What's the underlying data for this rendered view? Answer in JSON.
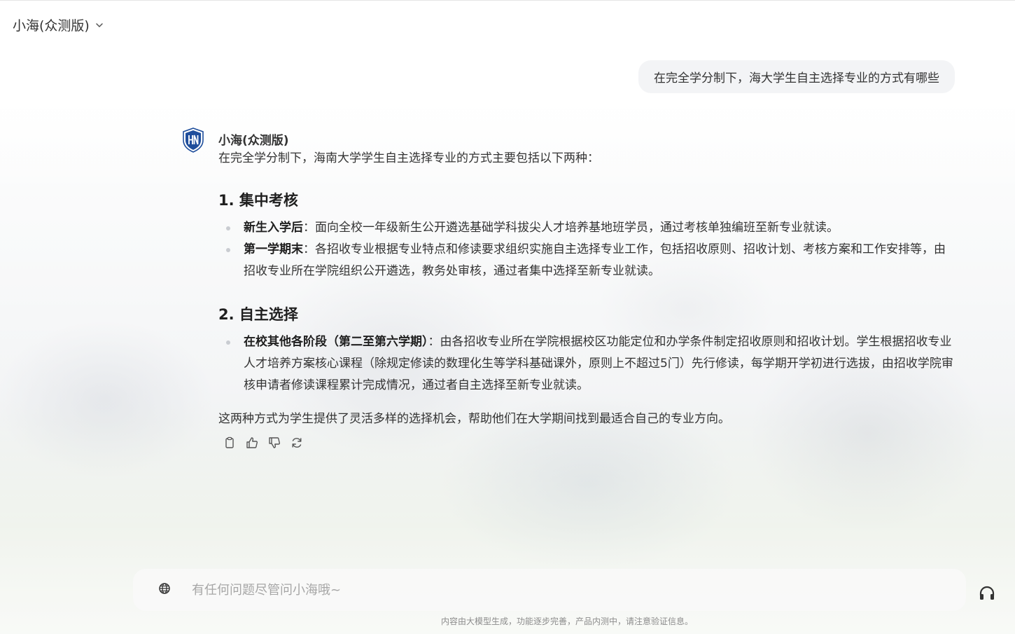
{
  "header": {
    "title": "小海(众测版)",
    "chevron_icon": "chevron-down-icon"
  },
  "user_message": "在完全学分制下，海大学生自主选择专业的方式有哪些",
  "assistant": {
    "name": "小海(众测版)",
    "intro": "在完全学分制下，海南大学学生自主选择专业的方式主要包括以下两种：",
    "sections": [
      {
        "heading": "1. 集中考核",
        "items": [
          {
            "label": "新生入学后",
            "text": "：面向全校一年级新生公开遴选基础学科拔尖人才培养基地班学员，通过考核单独编班至新专业就读。"
          },
          {
            "label": "第一学期末",
            "text": "：各招收专业根据专业特点和修读要求组织实施自主选择专业工作，包括招收原则、招收计划、考核方案和工作安排等，由招收专业所在学院组织公开遴选，教务处审核，通过者集中选择至新专业就读。"
          }
        ]
      },
      {
        "heading": "2. 自主选择",
        "items": [
          {
            "label": "在校其他各阶段（第二至第六学期）",
            "text": "：由各招收专业所在学院根据校区功能定位和办学条件制定招收原则和招收计划。学生根据招收专业人才培养方案核心课程（除规定修读的数理化生等学科基础课外，原则上不超过5门）先行修读，每学期开学初进行选拔，由招收学院审核申请者修读课程累计完成情况，通过者自主选择至新专业就读。"
          }
        ]
      }
    ],
    "summary": "这两种方式为学生提供了灵活多样的选择机会，帮助他们在大学期间找到最适合自己的专业方向。",
    "actions": [
      "copy-icon",
      "thumbs-up-icon",
      "thumbs-down-icon",
      "refresh-icon"
    ]
  },
  "composer": {
    "placeholder": "有任何问题尽管问小海哦~",
    "left_icon": "globe-icon",
    "right_icon": "headset-icon"
  },
  "footer_note": "内容由大模型生成，功能逐步完善，产品内测中，请注意验证信息。",
  "colors": {
    "user_bubble": "#f3f4f6",
    "avatar_blue": "#1f4e9c",
    "text": "#333333",
    "placeholder": "#a6a6a6"
  }
}
